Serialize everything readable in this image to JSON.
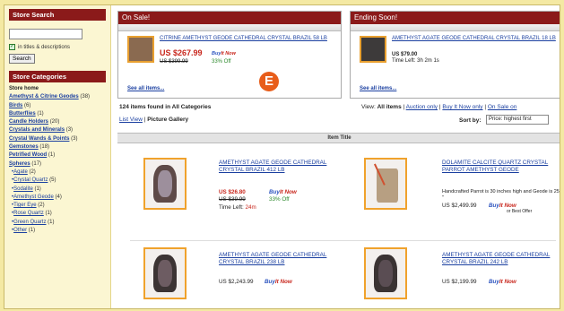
{
  "sidebar": {
    "search_title": "Store Search",
    "checkbox_label": "in titles & descriptions",
    "search_button": "Search",
    "categories_title": "Store Categories",
    "store_home": "Store home",
    "categories": [
      {
        "label": "Amethyst & Citrine Geodes",
        "count": "(38)",
        "sub": false
      },
      {
        "label": "Birds",
        "count": "(6)",
        "sub": false
      },
      {
        "label": "Butterflies",
        "count": "(1)",
        "sub": false
      },
      {
        "label": "Candle Holders",
        "count": "(20)",
        "sub": false
      },
      {
        "label": "Crystals and Minerals",
        "count": "(3)",
        "sub": false
      },
      {
        "label": "Crystal Wands & Points",
        "count": "(3)",
        "sub": false
      },
      {
        "label": "Gemstones",
        "count": "(18)",
        "sub": false
      },
      {
        "label": "Petrified Wood",
        "count": "(1)",
        "sub": false
      },
      {
        "label": "Spheres",
        "count": "(17)",
        "sub": false
      },
      {
        "label": "Agate",
        "count": "(2)",
        "sub": true
      },
      {
        "label": "Crystal Quartz",
        "count": "(5)",
        "sub": true
      },
      {
        "label": "Sodalite",
        "count": "(1)",
        "sub": true
      },
      {
        "label": "Amethyst Geode",
        "count": "(4)",
        "sub": true
      },
      {
        "label": "Tiger Eye",
        "count": "(2)",
        "sub": true
      },
      {
        "label": "Rose Quartz",
        "count": "(1)",
        "sub": true
      },
      {
        "label": "Green Quartz",
        "count": "(1)",
        "sub": true
      },
      {
        "label": "Other",
        "count": "(1)",
        "sub": true
      }
    ]
  },
  "on_sale": {
    "title": "On Sale!",
    "item_title": "CITRINE AMETHYST GEODE CATHEDRAL CRYSTAL BRAZIL 58 LB",
    "price": "US $267.99",
    "old_price": "US $399.99",
    "discount": "33% Off",
    "see_all": "See all items..."
  },
  "ending_soon": {
    "title": "Ending Soon!",
    "item_title": "AMETHYST AGATE GEODE CATHEDRAL CRYSTAL BRAZIL 18 LB",
    "price": "US $79.00",
    "time_left": "Time Left: 3h 2m 1s",
    "see_all": "See all items..."
  },
  "badge": "E",
  "results": {
    "count_text": "124 items found in All Categories",
    "view_label": "View:",
    "view_all": "All items",
    "view_auction": "Auction only",
    "view_bin": "Buy It Now only",
    "view_sale": "On Sale on",
    "list_view": "List View",
    "picture_gallery": "Picture Gallery",
    "sort_label": "Sort by:",
    "sort_value": "Price: highest first",
    "column_header": "Item Title"
  },
  "buy_it_now": {
    "prefix": "Buy",
    "suffix": "It Now"
  },
  "items": [
    {
      "title": "AMETHYST AGATE GEODE CATHEDRAL CRYSTAL BRAZIL 412 LB",
      "price": "US $26.80",
      "old": "US $39.99",
      "off": "33% Off",
      "time_label": "Time Left:",
      "time": "24m"
    },
    {
      "title": "DOLAMITE CALCITE QUARTZ CRYSTAL PARROT AMETHYST GEODE",
      "desc": "Handcrafted Parrot is 30 inches high and Geode is 25 \"",
      "price": "US $2,499.99",
      "best": "or Best Offer"
    },
    {
      "title": "AMETHYST AGATE GEODE CATHEDRAL CRYSTAL BRAZIL 238 LB",
      "price": "US $2,243.99"
    },
    {
      "title": "AMETHYST AGATE GEODE CATHEDRAL CRYSTAL BRAZIL 242 LB",
      "price": "US $2,199.99"
    }
  ]
}
